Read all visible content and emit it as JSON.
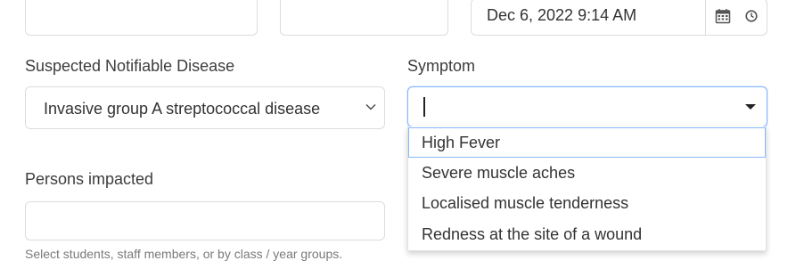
{
  "top_row": {
    "datetime_value": "Dec 6, 2022 9:14 AM"
  },
  "disease": {
    "label": "Suspected Notifiable Disease",
    "value": "Invasive group A streptococcal disease"
  },
  "symptom": {
    "label": "Symptom",
    "value": "",
    "options": [
      "High Fever",
      "Severe muscle aches",
      "Localised muscle tenderness",
      "Redness at the site of a wound"
    ]
  },
  "persons": {
    "label": "Persons impacted",
    "value": "",
    "help": "Select students, staff members, or by class / year groups."
  }
}
